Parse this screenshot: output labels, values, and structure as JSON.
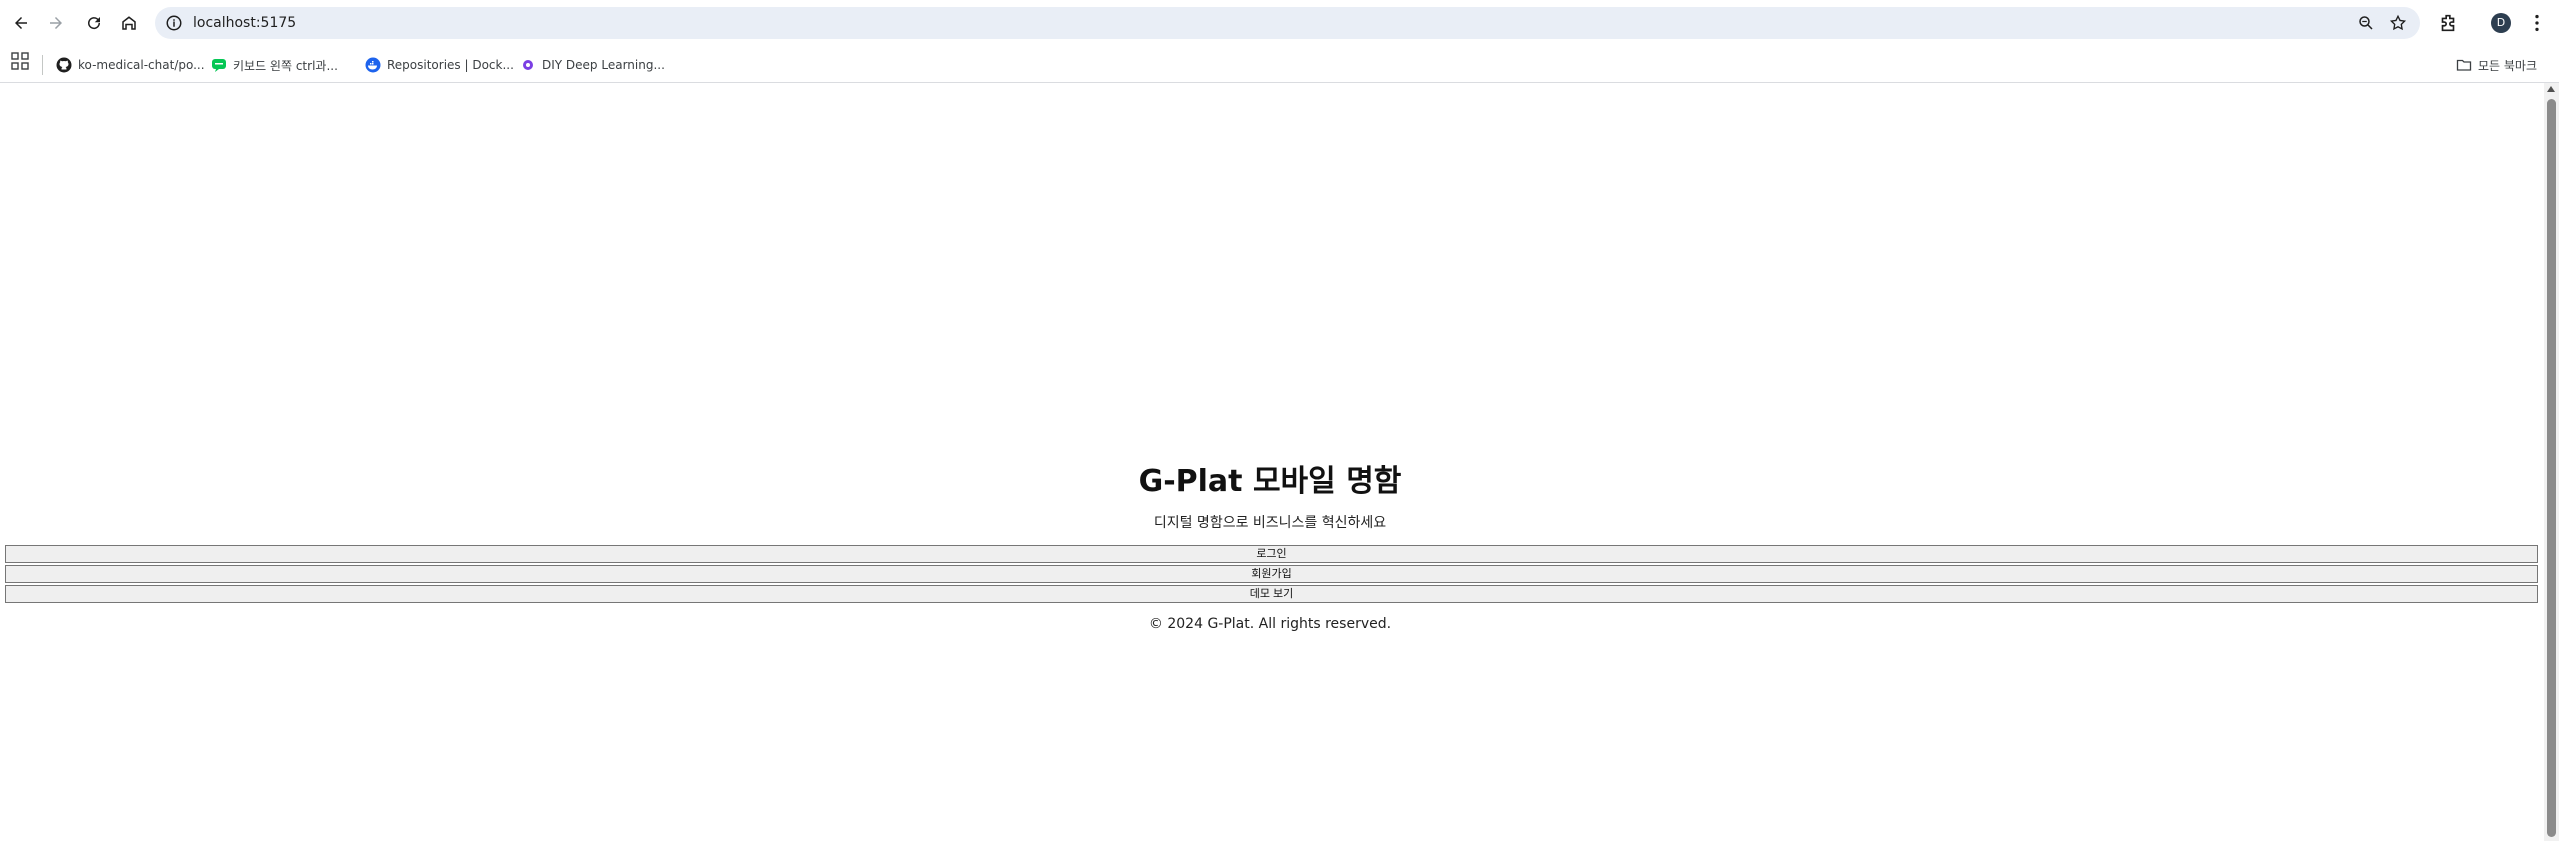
{
  "browser": {
    "url": "localhost:5175",
    "avatar_initial": "D",
    "bookmarks": [
      {
        "label": "ko-medical-chat/po...",
        "icon": "github-icon"
      },
      {
        "label": "키보드 왼쪽 ctrl과...",
        "icon": "chat-bubble-icon"
      },
      {
        "label": "Repositories | Dock...",
        "icon": "docker-icon"
      },
      {
        "label": "DIY Deep Learning...",
        "icon": "diy-icon"
      }
    ],
    "all_bookmarks_label": "모든 북마크"
  },
  "page": {
    "title": "G-Plat 모바일 명함",
    "subtitle": "디지털 명함으로 비즈니스를 혁신하세요",
    "buttons": {
      "login": "로그인",
      "signup": "회원가입",
      "demo": "데모 보기"
    },
    "footer": "© 2024 G-Plat. All rights reserved."
  },
  "colors": {
    "omnibox_bg": "#e9eef6",
    "button_bg": "#efefef",
    "button_border": "#767676"
  }
}
